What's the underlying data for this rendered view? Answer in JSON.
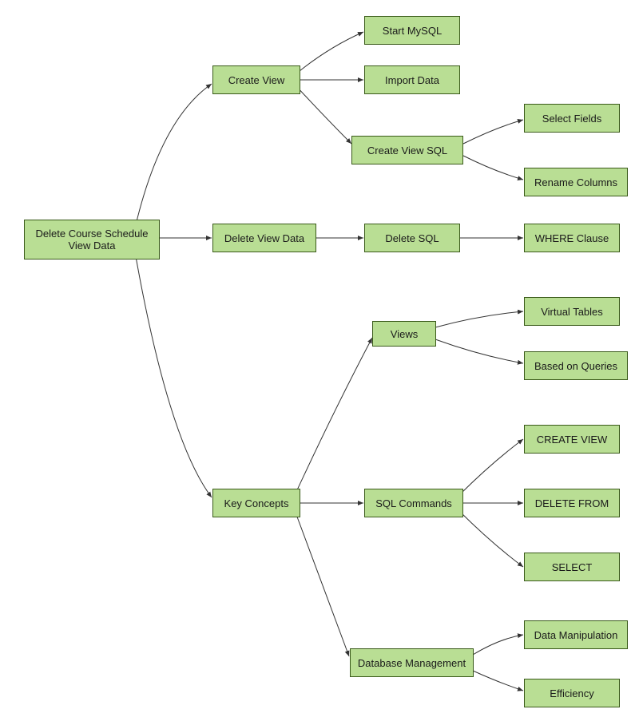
{
  "diagram": {
    "root": "Delete Course Schedule View Data",
    "createView": {
      "label": "Create View",
      "startMysql": "Start MySQL",
      "importData": "Import Data",
      "createViewSql": {
        "label": "Create View SQL",
        "selectFields": "Select Fields",
        "renameColumns": "Rename Columns"
      }
    },
    "deleteViewData": {
      "label": "Delete View Data",
      "deleteSql": {
        "label": "Delete SQL",
        "whereClause": "WHERE Clause"
      }
    },
    "keyConcepts": {
      "label": "Key Concepts",
      "views": {
        "label": "Views",
        "virtualTables": "Virtual Tables",
        "basedOnQueries": "Based on Queries"
      },
      "sqlCommands": {
        "label": "SQL Commands",
        "createView": "CREATE VIEW",
        "deleteFrom": "DELETE FROM",
        "select": "SELECT"
      },
      "databaseManagement": {
        "label": "Database Management",
        "dataManipulation": "Data Manipulation",
        "efficiency": "Efficiency"
      }
    }
  }
}
